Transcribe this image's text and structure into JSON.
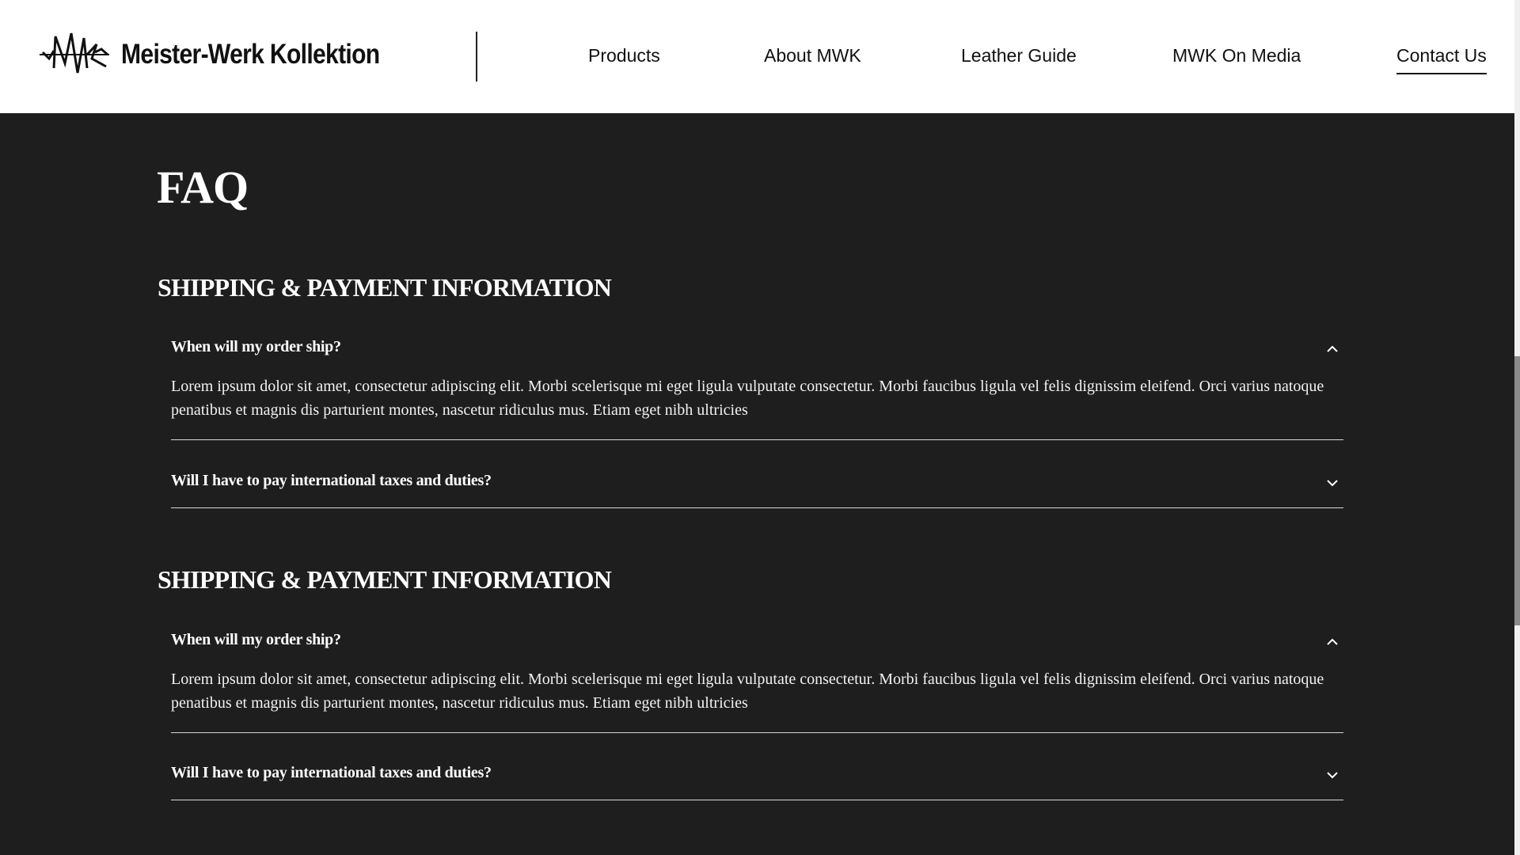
{
  "brand": {
    "name": "Meister-Werk Kollektion",
    "logo_icon": "mwk-monogram-icon"
  },
  "nav": {
    "items": [
      {
        "label": "Products"
      },
      {
        "label": "About MWK"
      },
      {
        "label": "Leather Guide"
      },
      {
        "label": "MWK On Media"
      },
      {
        "label": "Contact Us",
        "active": true
      }
    ]
  },
  "page": {
    "title": "FAQ"
  },
  "sections": [
    {
      "title": "SHIPPING & PAYMENT INFORMATION",
      "items": [
        {
          "question": "When will my order ship?",
          "expanded": true,
          "toggle_icon": "chevron-up-icon",
          "answer": "Lorem ipsum dolor sit amet, consectetur adipiscing elit. Morbi scelerisque mi eget ligula vulputate consectetur. Morbi faucibus ligula vel felis dignissim eleifend. Orci varius natoque penatibus et magnis dis parturient montes, nascetur ridiculus mus. Etiam eget nibh ultricies"
        },
        {
          "question": "Will I have to pay international taxes and duties?",
          "expanded": false,
          "toggle_icon": "chevron-down-icon"
        }
      ]
    },
    {
      "title": "SHIPPING & PAYMENT INFORMATION",
      "items": [
        {
          "question": "When will my order ship?",
          "expanded": true,
          "toggle_icon": "chevron-up-icon",
          "answer": "Lorem ipsum dolor sit amet, consectetur adipiscing elit. Morbi scelerisque mi eget ligula vulputate consectetur. Morbi faucibus ligula vel felis dignissim eleifend. Orci varius natoque penatibus et magnis dis parturient montes, nascetur ridiculus mus. Etiam eget nibh ultricies"
        },
        {
          "question": "Will I have to pay international taxes and duties?",
          "expanded": false,
          "toggle_icon": "chevron-down-icon"
        }
      ]
    }
  ],
  "colors": {
    "header_bg": "#ffffff",
    "content_bg": "#1e1e1e",
    "text_light": "#ffffff",
    "text_dark": "#111111",
    "divider": "#d9d9d9"
  }
}
